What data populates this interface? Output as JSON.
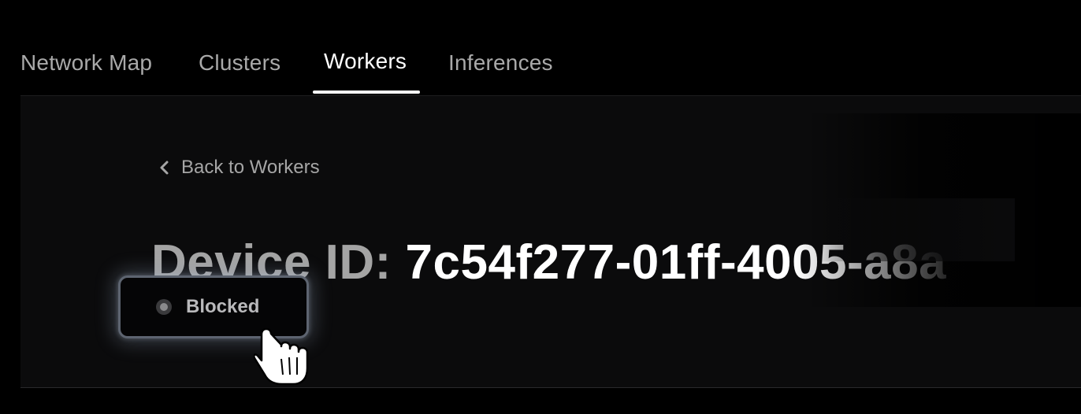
{
  "tabs": [
    {
      "label": "Network Map",
      "active": false
    },
    {
      "label": "Clusters",
      "active": false
    },
    {
      "label": "Workers",
      "active": true
    },
    {
      "label": "Inferences",
      "active": false
    }
  ],
  "back_link": {
    "label": "Back to Workers",
    "icon": "chevron-left-icon"
  },
  "device": {
    "prefix": "Device ID:",
    "id": "7c54f277-01ff-4005-a8a"
  },
  "status": {
    "label": "Blocked",
    "dot_color": "#8a8a8c"
  },
  "cursor": {
    "icon": "hand-pointer-icon"
  },
  "colors": {
    "background": "#000000",
    "panel": "#0b0b0c",
    "active_tab": "#ffffff",
    "inactive_tab": "#a9a9a9",
    "status_border": "#5d6470"
  }
}
